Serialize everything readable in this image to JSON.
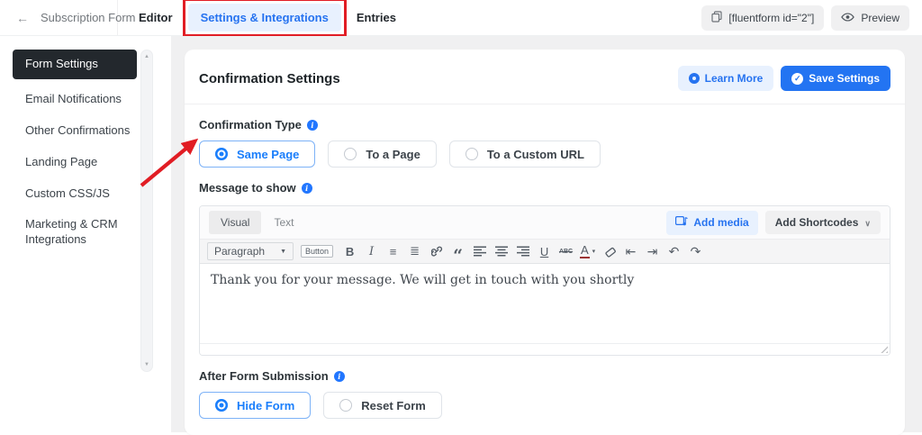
{
  "colors": {
    "accent_blue": "#1a7efb",
    "primary_button_blue": "#2374f2",
    "light_blue_bg": "#e8f1fe",
    "active_sidebar_bg": "#23282d",
    "page_bg": "#f0f0f1",
    "annotation_red": "#e11d24"
  },
  "topbar": {
    "back_icon": "←",
    "form_title": "Subscription Form",
    "tabs": [
      {
        "label": "Editor",
        "active": false
      },
      {
        "label": "Settings & Integrations",
        "active": true,
        "annotated": true
      },
      {
        "label": "Entries",
        "active": false
      }
    ],
    "shortcode_button": {
      "label": "[fluentform id=\"2\"]"
    },
    "preview_button": {
      "label": "Preview"
    }
  },
  "sidebar": {
    "items": [
      {
        "label": "Form Settings",
        "active": true
      },
      {
        "label": "Email Notifications",
        "active": false
      },
      {
        "label": "Other Confirmations",
        "active": false
      },
      {
        "label": "Landing Page",
        "active": false
      },
      {
        "label": "Custom CSS/JS",
        "active": false
      },
      {
        "label": "Marketing & CRM Integrations",
        "active": false
      }
    ]
  },
  "settings": {
    "title": "Confirmation Settings",
    "learn_more_label": "Learn More",
    "save_settings_label": "Save Settings",
    "confirmation_type": {
      "label": "Confirmation Type",
      "options": [
        {
          "label": "Same Page",
          "selected": true
        },
        {
          "label": "To a Page",
          "selected": false
        },
        {
          "label": "To a Custom URL",
          "selected": false
        }
      ]
    },
    "message_to_show": {
      "label": "Message to show"
    },
    "editor": {
      "tabs": [
        {
          "label": "Visual",
          "active": true
        },
        {
          "label": "Text",
          "active": false
        }
      ],
      "add_media_label": "Add media",
      "add_shortcodes_label": "Add Shortcodes",
      "toolbar": {
        "paragraph_label": "Paragraph",
        "button_label": "Button",
        "icons": [
          {
            "name": "bold-icon",
            "glyph": "B"
          },
          {
            "name": "italic-icon",
            "glyph": "I"
          },
          {
            "name": "bullet-list-icon",
            "glyph": "≡"
          },
          {
            "name": "numbered-list-icon",
            "glyph": "≣"
          },
          {
            "name": "link-icon",
            "shape": "svg"
          },
          {
            "name": "blockquote-icon",
            "glyph": "“"
          },
          {
            "name": "align-left-icon",
            "shape": "svg"
          },
          {
            "name": "align-center-icon",
            "shape": "svg"
          },
          {
            "name": "align-right-icon",
            "shape": "svg"
          },
          {
            "name": "underline-icon",
            "glyph": "U"
          },
          {
            "name": "strikethrough-icon",
            "glyph": "ABC"
          },
          {
            "name": "text-color-icon",
            "glyph": "A"
          },
          {
            "name": "clear-formatting-icon",
            "shape": "svg"
          },
          {
            "name": "outdent-icon",
            "glyph": "⇤"
          },
          {
            "name": "indent-icon",
            "glyph": "⇥"
          },
          {
            "name": "undo-icon",
            "glyph": "↶"
          },
          {
            "name": "redo-icon",
            "glyph": "↷"
          }
        ]
      },
      "content": "Thank you for your message. We will get in touch with you shortly"
    },
    "after_form_submission": {
      "label": "After Form Submission",
      "options": [
        {
          "label": "Hide Form",
          "selected": true
        },
        {
          "label": "Reset Form",
          "selected": false
        }
      ]
    }
  }
}
